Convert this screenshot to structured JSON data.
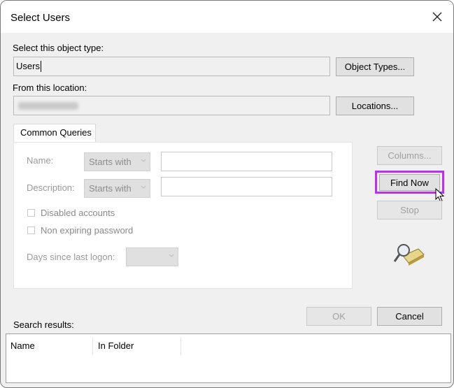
{
  "window": {
    "title": "Select Users"
  },
  "object_type": {
    "label": "Select this object type:",
    "value": "Users",
    "button": "Object Types..."
  },
  "location": {
    "label": "From this location:",
    "button": "Locations..."
  },
  "queries": {
    "tab": "Common Queries",
    "name_label": "Name:",
    "name_mode": "Starts with",
    "description_label": "Description:",
    "description_mode": "Starts with",
    "disabled_accounts": "Disabled accounts",
    "non_expiring": "Non expiring password",
    "days_label": "Days since last logon:"
  },
  "side_buttons": {
    "columns": "Columns...",
    "find_now": "Find Now",
    "stop": "Stop"
  },
  "dialog_buttons": {
    "ok": "OK",
    "cancel": "Cancel"
  },
  "results": {
    "label": "Search results:",
    "columns": [
      "Name",
      "In Folder"
    ]
  },
  "colors": {
    "highlight": "#a83ed6"
  },
  "icons": [
    "close-icon",
    "chevron-down-icon",
    "search-magnifier-icon",
    "mouse-cursor-icon"
  ]
}
